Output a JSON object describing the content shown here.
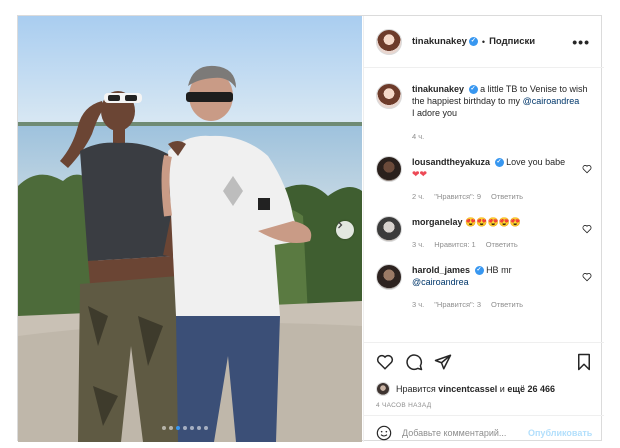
{
  "post": {
    "author": "tinakunakey",
    "follow_state": "Подписки",
    "separator": "•",
    "more_label": "•••",
    "caption": {
      "user": "tinakunakey",
      "text_before": "a little TB to Venise to wish the happiest birthday to my",
      "mention": "@cairoandrea",
      "text_after": "I adore you",
      "time": "4 ч."
    },
    "comments": [
      {
        "user": "lousandtheyakuza",
        "verified": true,
        "text": "Love you babe",
        "emoji": "❤❤",
        "time": "2 ч.",
        "likes": "\"Нравится\": 9",
        "reply": "Ответить"
      },
      {
        "user": "morganelay",
        "verified": false,
        "text": "",
        "emoji": "😍😍😍😍😍",
        "time": "3 ч.",
        "likes": "Нравится: 1",
        "reply": "Ответить"
      },
      {
        "user": "harold_james",
        "verified": true,
        "text": "HB mr",
        "mention": "@cairoandrea",
        "time": "3 ч.",
        "likes": "\"Нравится\": 3",
        "reply": "Ответить"
      }
    ],
    "likes": {
      "prefix": "Нравится",
      "user": "vincentcassel",
      "middle": "и",
      "count": "ещё 26 466"
    },
    "date": "4 ЧАСОВ НАЗАД",
    "add_comment_placeholder": "Добавьте комментарий...",
    "publish_label": "Опубликовать",
    "carousel": {
      "total": 7,
      "active": 2
    }
  },
  "icons": [
    "heart-icon",
    "comment-icon",
    "share-icon",
    "bookmark-icon",
    "emoji-icon",
    "verified-icon",
    "chevron-right-icon",
    "more-icon"
  ],
  "colors": {
    "link": "#00376b",
    "accent": "#3897f0",
    "muted": "#8e8e8e",
    "publish_disabled": "#b2dffc",
    "heart": "#ed4956"
  }
}
